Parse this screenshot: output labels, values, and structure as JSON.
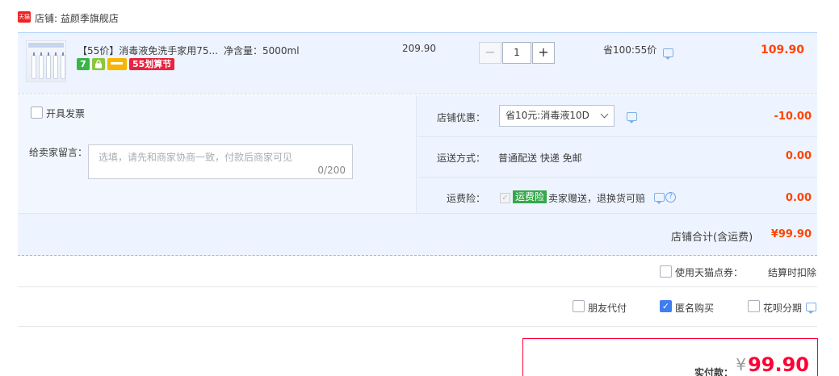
{
  "shop": {
    "badge": "天猫",
    "label": "店铺:",
    "name": "益颜季旗舰店"
  },
  "item": {
    "title": "【55价】消毒液免洗手家用75...",
    "spec": "净含量：5000ml",
    "tags": [
      "7",
      "锁",
      "卡",
      "55划算节"
    ],
    "unit_price": "209.90",
    "quantity": "1",
    "minus": "−",
    "plus": "+",
    "saving": "省100:55价",
    "total": "109.90"
  },
  "options": {
    "invoice_label": "开具发票",
    "message_label": "给卖家留言：",
    "message_placeholder": "选填，请先和商家协商一致，付款后商家可见",
    "message_count": "0/200",
    "coupon_label": "店铺优惠：",
    "coupon_selected": "省10元:消毒液10D",
    "coupon_amount": "-10.00",
    "shipping_label": "运送方式：",
    "shipping_value": "普通配送 快递 免邮",
    "shipping_amount": "0.00",
    "insurance_label": "运费险：",
    "insurance_badge": "运费险",
    "insurance_text": "卖家赠送，退换货可赔",
    "insurance_amount": "0.00",
    "shop_total_label": "店铺合计(含运费)",
    "shop_total": "¥99.90"
  },
  "extras": {
    "tmall_points_label": "使用天猫点券：",
    "tmall_points_value": "结算时扣除",
    "friend_pay_label": "朋友代付",
    "anonymous_label": "匿名购买",
    "anonymous_checked": true,
    "huabei_label": "花呗分期"
  },
  "payment": {
    "label": "实付款：",
    "currency": "¥",
    "amount": "99.90"
  },
  "colors": {
    "accent_red": "#ff4400",
    "pay_red": "#ff0036",
    "row_bg": "#eef4ff",
    "checkbox_blue": "#3f7ef0"
  }
}
